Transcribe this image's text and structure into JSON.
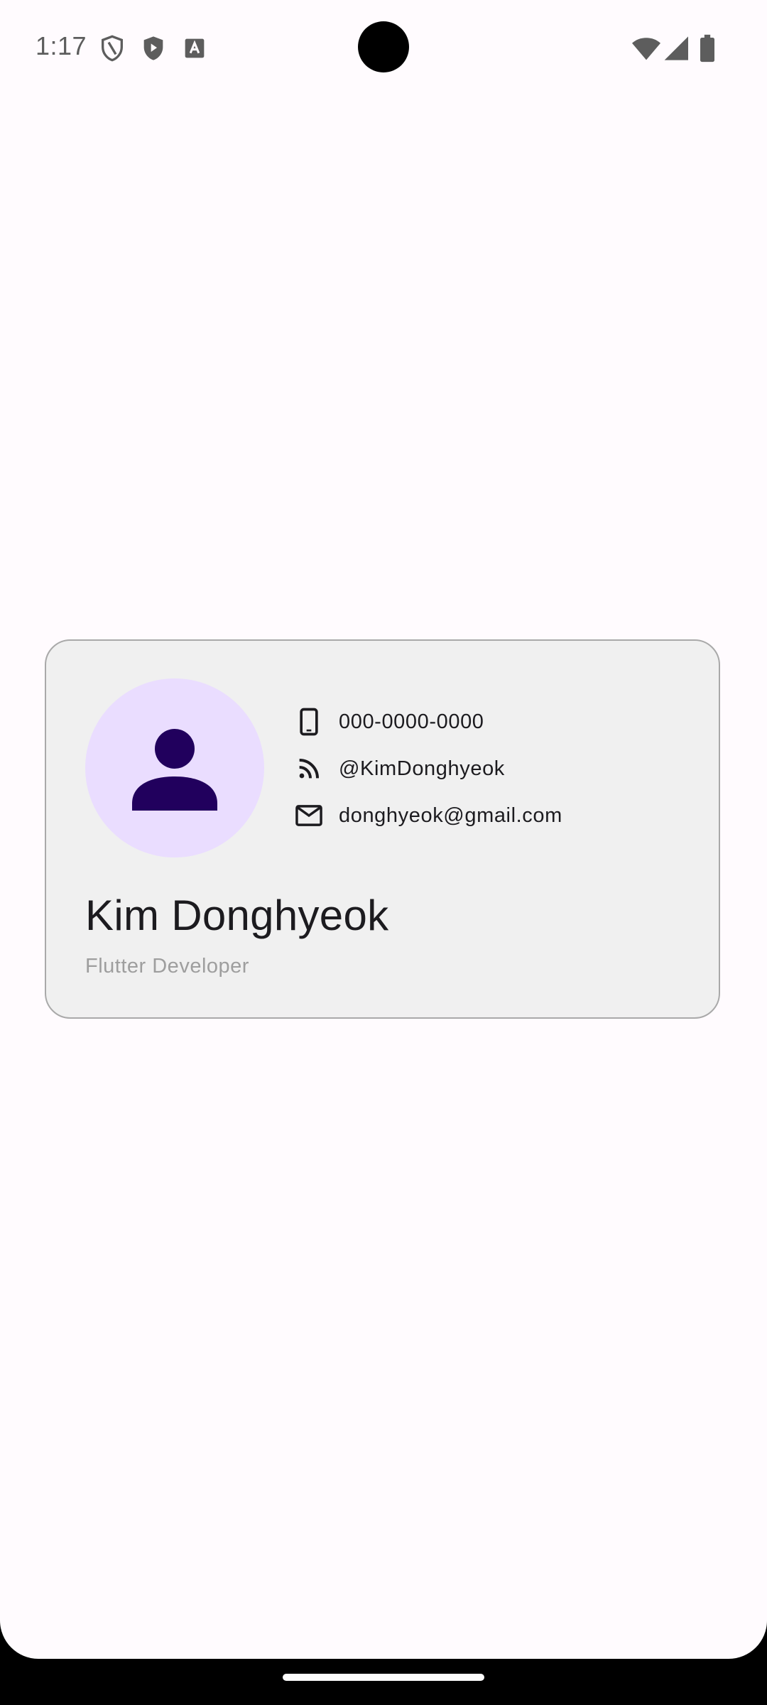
{
  "status_bar": {
    "time": "1:17",
    "left_icons": [
      "shield-outline-icon",
      "play-shield-icon",
      "font-a-icon"
    ],
    "right_icons": [
      "wifi-icon",
      "signal-icon",
      "battery-icon"
    ]
  },
  "card": {
    "avatar_icon": "person-icon",
    "contacts": [
      {
        "icon": "phone-icon",
        "text": "000-0000-0000"
      },
      {
        "icon": "rss-feed-icon",
        "text": "@KimDonghyeok"
      },
      {
        "icon": "mail-icon",
        "text": "donghyeok@gmail.com"
      }
    ],
    "name": "Kim Donghyeok",
    "role": "Flutter Developer"
  },
  "colors": {
    "background": "#fffbfe",
    "card_bg": "#f0f0f0",
    "avatar_bg": "#eaddff",
    "avatar_fg": "#21005d",
    "text_primary": "#1c1b1f",
    "text_secondary": "#9e9e9e"
  }
}
